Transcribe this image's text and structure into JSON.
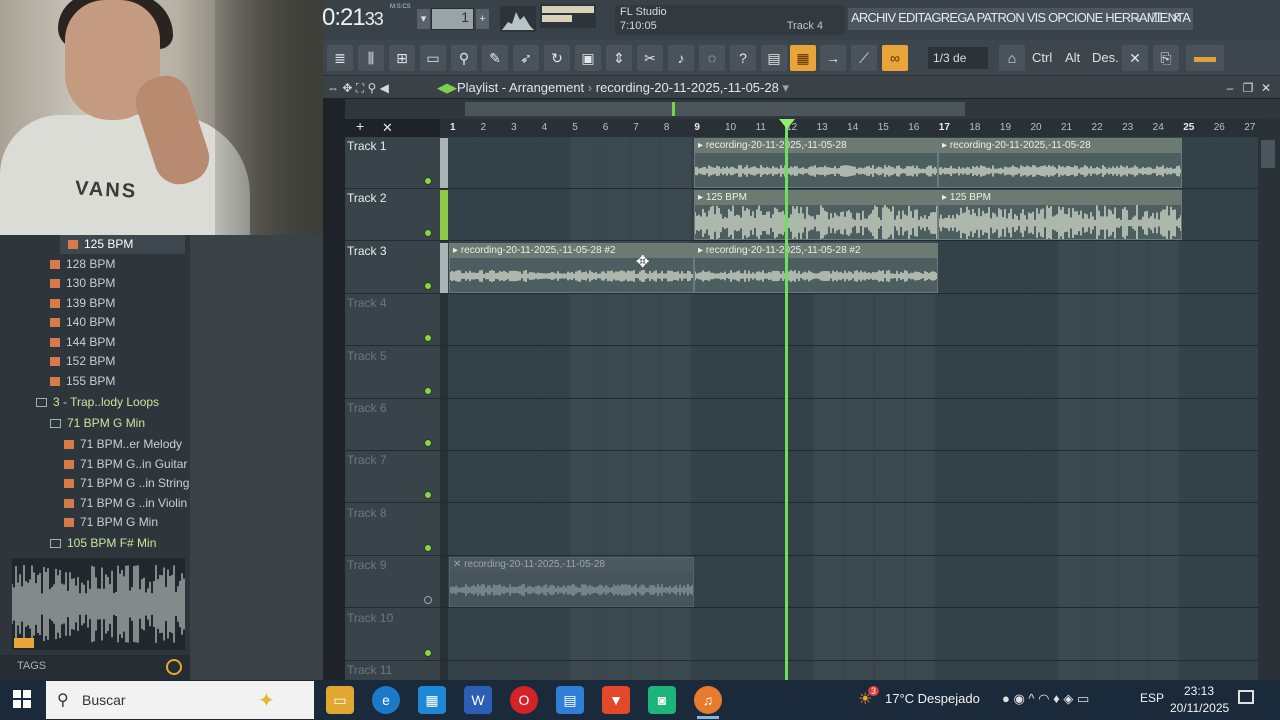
{
  "topbar": {
    "time_main": "0:21",
    "time_small": "33",
    "time_unit": "M:S:CS",
    "tempo_value": "1",
    "hint_line1": "FL Studio",
    "hint_line2": "7:10:05",
    "hint_right": "Track 4",
    "menu": "ARCHIV EDITAGREGA PATRON VIS OPCIONE HERRAMIENTA",
    "minimize": "–",
    "restore": "❐",
    "close": "✕"
  },
  "toolbar": {
    "snap": "1/3 de pa..",
    "key_ctrl": "Ctrl",
    "key_alt": "Alt",
    "key_des": "Des."
  },
  "browser": {
    "items": [
      {
        "label": "125 BPM",
        "kind": "file",
        "selected": true
      },
      {
        "label": "128 BPM",
        "kind": "file"
      },
      {
        "label": "130 BPM",
        "kind": "file"
      },
      {
        "label": "139 BPM",
        "kind": "file"
      },
      {
        "label": "140 BPM",
        "kind": "file"
      },
      {
        "label": "144 BPM",
        "kind": "file"
      },
      {
        "label": "152 BPM",
        "kind": "file"
      },
      {
        "label": "155 BPM",
        "kind": "file"
      },
      {
        "label": "3 - Trap..lody Loops",
        "kind": "folder"
      },
      {
        "label": "71 BPM G Min",
        "kind": "folder"
      },
      {
        "label": "71 BPM..er Melody",
        "kind": "file"
      },
      {
        "label": "71 BPM G..in Guitar",
        "kind": "file"
      },
      {
        "label": "71 BPM G ..in String",
        "kind": "file"
      },
      {
        "label": "71 BPM G ..in Violin",
        "kind": "file"
      },
      {
        "label": "71 BPM G Min",
        "kind": "file"
      },
      {
        "label": "105 BPM F# Min",
        "kind": "folder"
      }
    ],
    "tags_label": "TAGS"
  },
  "playlist": {
    "title": "Playlist - Arrangement",
    "arrow": "›",
    "pattern": "recording-20-11-2025,-11-05-28",
    "bars": [
      "1",
      "2",
      "3",
      "4",
      "5",
      "6",
      "7",
      "8",
      "9",
      "10",
      "11",
      "12",
      "13",
      "14",
      "15",
      "16",
      "17",
      "18",
      "19",
      "20",
      "21",
      "22",
      "23",
      "24",
      "25",
      "26",
      "27"
    ],
    "tracks": [
      {
        "name": "Track 1",
        "active": true
      },
      {
        "name": "Track 2",
        "active": true
      },
      {
        "name": "Track 3",
        "active": true
      },
      {
        "name": "Track 4",
        "active": false
      },
      {
        "name": "Track 5",
        "active": false
      },
      {
        "name": "Track 6",
        "active": false
      },
      {
        "name": "Track 7",
        "active": false
      },
      {
        "name": "Track 8",
        "active": false
      },
      {
        "name": "Track 9",
        "active": false
      },
      {
        "name": "Track 10",
        "active": false
      },
      {
        "name": "Track 11",
        "active": false
      }
    ],
    "clips": [
      {
        "track": 1,
        "label": "recording-20-11-2025,-11-05-28"
      },
      {
        "track": 1,
        "label": "recording-20-11-2025,-11-05-28"
      },
      {
        "track": 2,
        "label": "125 BPM"
      },
      {
        "track": 2,
        "label": "125 BPM"
      },
      {
        "track": 3,
        "label": "recording-20-11-2025,-11-05-28 #2"
      },
      {
        "track": 3,
        "label": "recording-20-11-2025,-11-05-28 #2"
      },
      {
        "track": 9,
        "label": "recording-20-11-2025,-11-05-28",
        "muted": true
      }
    ]
  },
  "taskbar": {
    "search": "Buscar",
    "weather": "17°C  Despejado",
    "weather_badge": "3",
    "lang": "ESP",
    "time": "23:13",
    "date": "20/11/2025"
  }
}
